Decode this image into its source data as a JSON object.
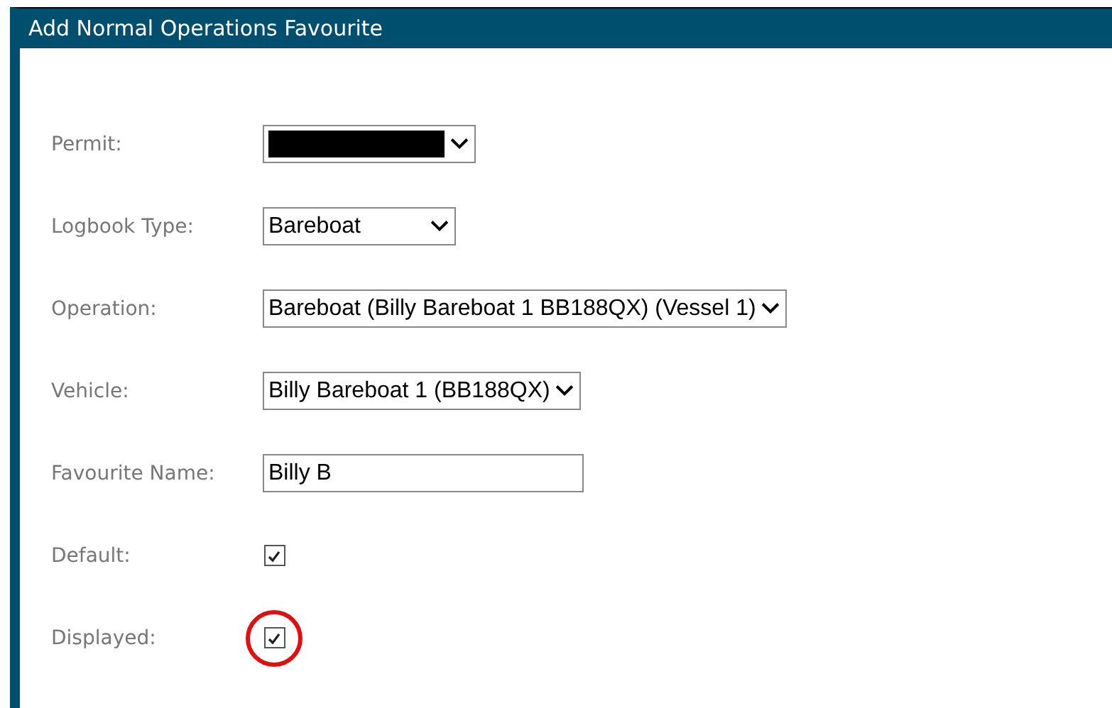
{
  "window": {
    "title": "Add Normal Operations Favourite"
  },
  "fields": [
    {
      "kind": "select",
      "label": "Permit:",
      "redacted": true
    },
    {
      "kind": "select",
      "label": "Logbook Type:",
      "value": "Bareboat"
    },
    {
      "kind": "select",
      "label": "Operation:",
      "value": "Bareboat (Billy Bareboat 1 BB188QX) (Vessel 1)"
    },
    {
      "kind": "select",
      "label": "Vehicle:",
      "value": "Billy Bareboat 1 (BB188QX)"
    },
    {
      "kind": "text",
      "label": "Favourite Name:",
      "value": "Billy B"
    },
    {
      "kind": "checkbox",
      "label": "Default:",
      "checked": true,
      "highlighted": false
    },
    {
      "kind": "checkbox",
      "label": "Displayed:",
      "checked": true,
      "highlighted": true
    }
  ]
}
